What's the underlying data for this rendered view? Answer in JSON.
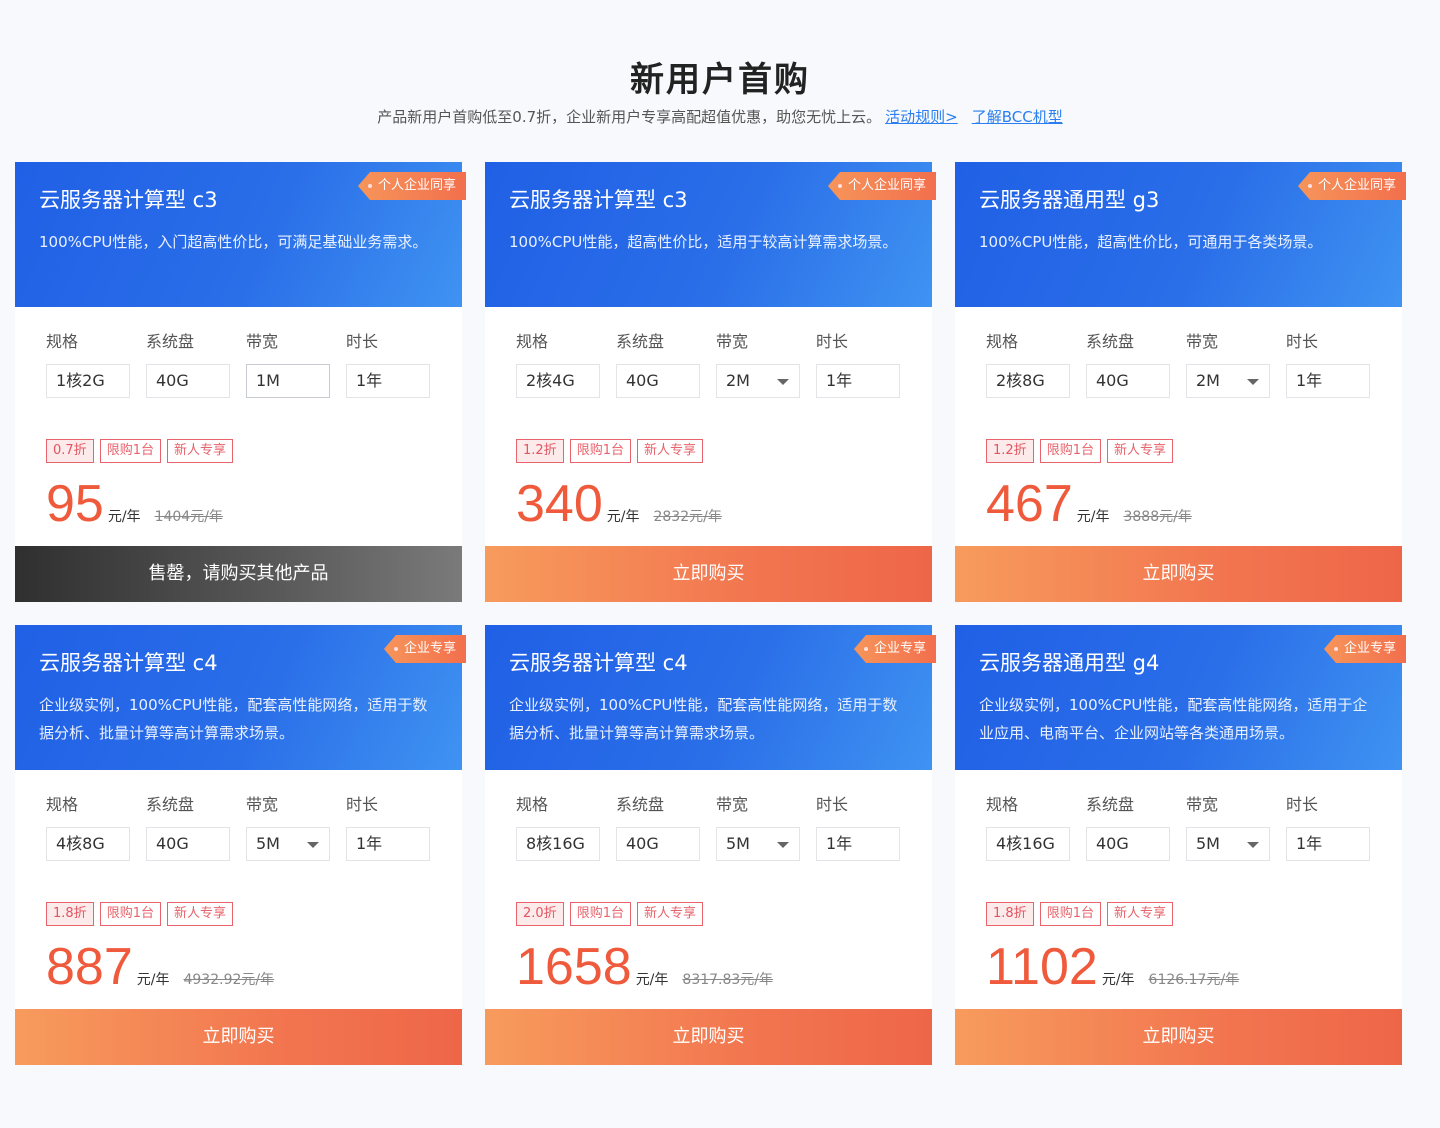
{
  "hero": {
    "title": "新用户首购",
    "subtitle": "产品新用户首购低至0.7折，企业新用户专享高配超值优惠，助您无忧上云。",
    "link_rules": "活动规则>",
    "link_bcc": "了解BCC机型"
  },
  "labels": {
    "spec": "规格",
    "disk": "系统盘",
    "bandwidth": "带宽",
    "duration": "时长"
  },
  "cards": [
    {
      "title": "云服务器计算型 c3",
      "desc": "100%CPU性能，入门超高性价比，可满足基础业务需求。",
      "ribbon": "个人企业同享",
      "spec": "1核2G",
      "disk": "40G",
      "bandwidth": "1M",
      "duration": "1年",
      "discount": "0.7折",
      "limit": "限购1台",
      "newuser": "新人专享",
      "price": "95",
      "unit": "元/年",
      "original": "1404元/年",
      "button": "售罄，请购买其他产品",
      "soldout": true,
      "bandwidth_dropdown": false
    },
    {
      "title": "云服务器计算型 c3",
      "desc": "100%CPU性能，超高性价比，适用于较高计算需求场景。",
      "ribbon": "个人企业同享",
      "spec": "2核4G",
      "disk": "40G",
      "bandwidth": "2M",
      "duration": "1年",
      "discount": "1.2折",
      "limit": "限购1台",
      "newuser": "新人专享",
      "price": "340",
      "unit": "元/年",
      "original": "2832元/年",
      "button": "立即购买",
      "soldout": false,
      "bandwidth_dropdown": true
    },
    {
      "title": "云服务器通用型 g3",
      "desc": "100%CPU性能，超高性价比，可通用于各类场景。",
      "ribbon": "个人企业同享",
      "spec": "2核8G",
      "disk": "40G",
      "bandwidth": "2M",
      "duration": "1年",
      "discount": "1.2折",
      "limit": "限购1台",
      "newuser": "新人专享",
      "price": "467",
      "unit": "元/年",
      "original": "3888元/年",
      "button": "立即购买",
      "soldout": false,
      "bandwidth_dropdown": true
    },
    {
      "title": "云服务器计算型 c4",
      "desc": "企业级实例，100%CPU性能，配套高性能网络，适用于数据分析、批量计算等高计算需求场景。",
      "ribbon": "企业专享",
      "spec": "4核8G",
      "disk": "40G",
      "bandwidth": "5M",
      "duration": "1年",
      "discount": "1.8折",
      "limit": "限购1台",
      "newuser": "新人专享",
      "price": "887",
      "unit": "元/年",
      "original": "4932.92元/年",
      "button": "立即购买",
      "soldout": false,
      "bandwidth_dropdown": true
    },
    {
      "title": "云服务器计算型 c4",
      "desc": "企业级实例，100%CPU性能，配套高性能网络，适用于数据分析、批量计算等高计算需求场景。",
      "ribbon": "企业专享",
      "spec": "8核16G",
      "disk": "40G",
      "bandwidth": "5M",
      "duration": "1年",
      "discount": "2.0折",
      "limit": "限购1台",
      "newuser": "新人专享",
      "price": "1658",
      "unit": "元/年",
      "original": "8317.83元/年",
      "button": "立即购买",
      "soldout": false,
      "bandwidth_dropdown": true
    },
    {
      "title": "云服务器通用型 g4",
      "desc": "企业级实例，100%CPU性能，配套高性能网络，适用于企业应用、电商平台、企业网站等各类通用场景。",
      "ribbon": "企业专享",
      "spec": "4核16G",
      "disk": "40G",
      "bandwidth": "5M",
      "duration": "1年",
      "discount": "1.8折",
      "limit": "限购1台",
      "newuser": "新人专享",
      "price": "1102",
      "unit": "元/年",
      "original": "6126.17元/年",
      "button": "立即购买",
      "soldout": false,
      "bandwidth_dropdown": true
    }
  ]
}
